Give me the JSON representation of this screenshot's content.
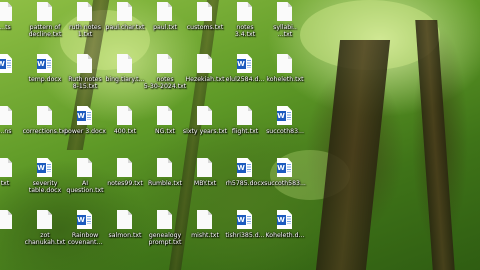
{
  "desktop": {
    "icons": [
      {
        "label": "...ts",
        "type": "txt"
      },
      {
        "label": "pattern of\ndecline.txt",
        "type": "txt"
      },
      {
        "label": "ruth notes\n1.txt",
        "type": "txt"
      },
      {
        "label": "paul.char.txt",
        "type": "txt"
      },
      {
        "label": "paul.txt",
        "type": "txt"
      },
      {
        "label": "customs.txt",
        "type": "txt"
      },
      {
        "label": "notes\n3.4.txt",
        "type": "txt"
      },
      {
        "label": "syllabi..\n...txt",
        "type": "txt"
      },
      {
        "label": "",
        "type": "docx"
      },
      {
        "label": "temp.docx",
        "type": "docx"
      },
      {
        "label": "Ruth notes\n8-15.txt",
        "type": "txt"
      },
      {
        "label": "bing.tiary.t...",
        "type": "txt"
      },
      {
        "label": "notes\n5-30-2024.txt",
        "type": "txt"
      },
      {
        "label": "Hezekiah.txt",
        "type": "txt"
      },
      {
        "label": "elul2584.d...",
        "type": "docx"
      },
      {
        "label": "koheleth.txt",
        "type": "txt"
      },
      {
        "label": "...ns",
        "type": "txt"
      },
      {
        "label": "corrections.txt",
        "type": "txt"
      },
      {
        "label": "power 3.docx",
        "type": "docx"
      },
      {
        "label": "400.txt",
        "type": "txt"
      },
      {
        "label": "NG.txt",
        "type": "txt"
      },
      {
        "label": "sixty years.txt",
        "type": "txt"
      },
      {
        "label": "flight.txt",
        "type": "txt"
      },
      {
        "label": "succoth83...",
        "type": "docx"
      },
      {
        "label": "txt",
        "type": "txt"
      },
      {
        "label": "severity\ntable.docx",
        "type": "docx"
      },
      {
        "label": "AI\nquestion.txt",
        "type": "txt"
      },
      {
        "label": "notes99.txt",
        "type": "txt"
      },
      {
        "label": "Rumble.txt",
        "type": "txt"
      },
      {
        "label": "MBY.txt",
        "type": "txt"
      },
      {
        "label": "rh5785.docx",
        "type": "docx"
      },
      {
        "label": "succoth583...",
        "type": "docx"
      },
      {
        "label": "",
        "type": "txt"
      },
      {
        "label": "zot\nchanukah.txt",
        "type": "txt"
      },
      {
        "label": "Rainbow\ncovenant...",
        "type": "docx"
      },
      {
        "label": "salmon.txt",
        "type": "txt"
      },
      {
        "label": "genealogy\nprompt.txt",
        "type": "txt"
      },
      {
        "label": "misht.txt",
        "type": "txt"
      },
      {
        "label": "tishri385.d...",
        "type": "docx"
      },
      {
        "label": "Koheleth.d...",
        "type": "docx"
      }
    ]
  }
}
